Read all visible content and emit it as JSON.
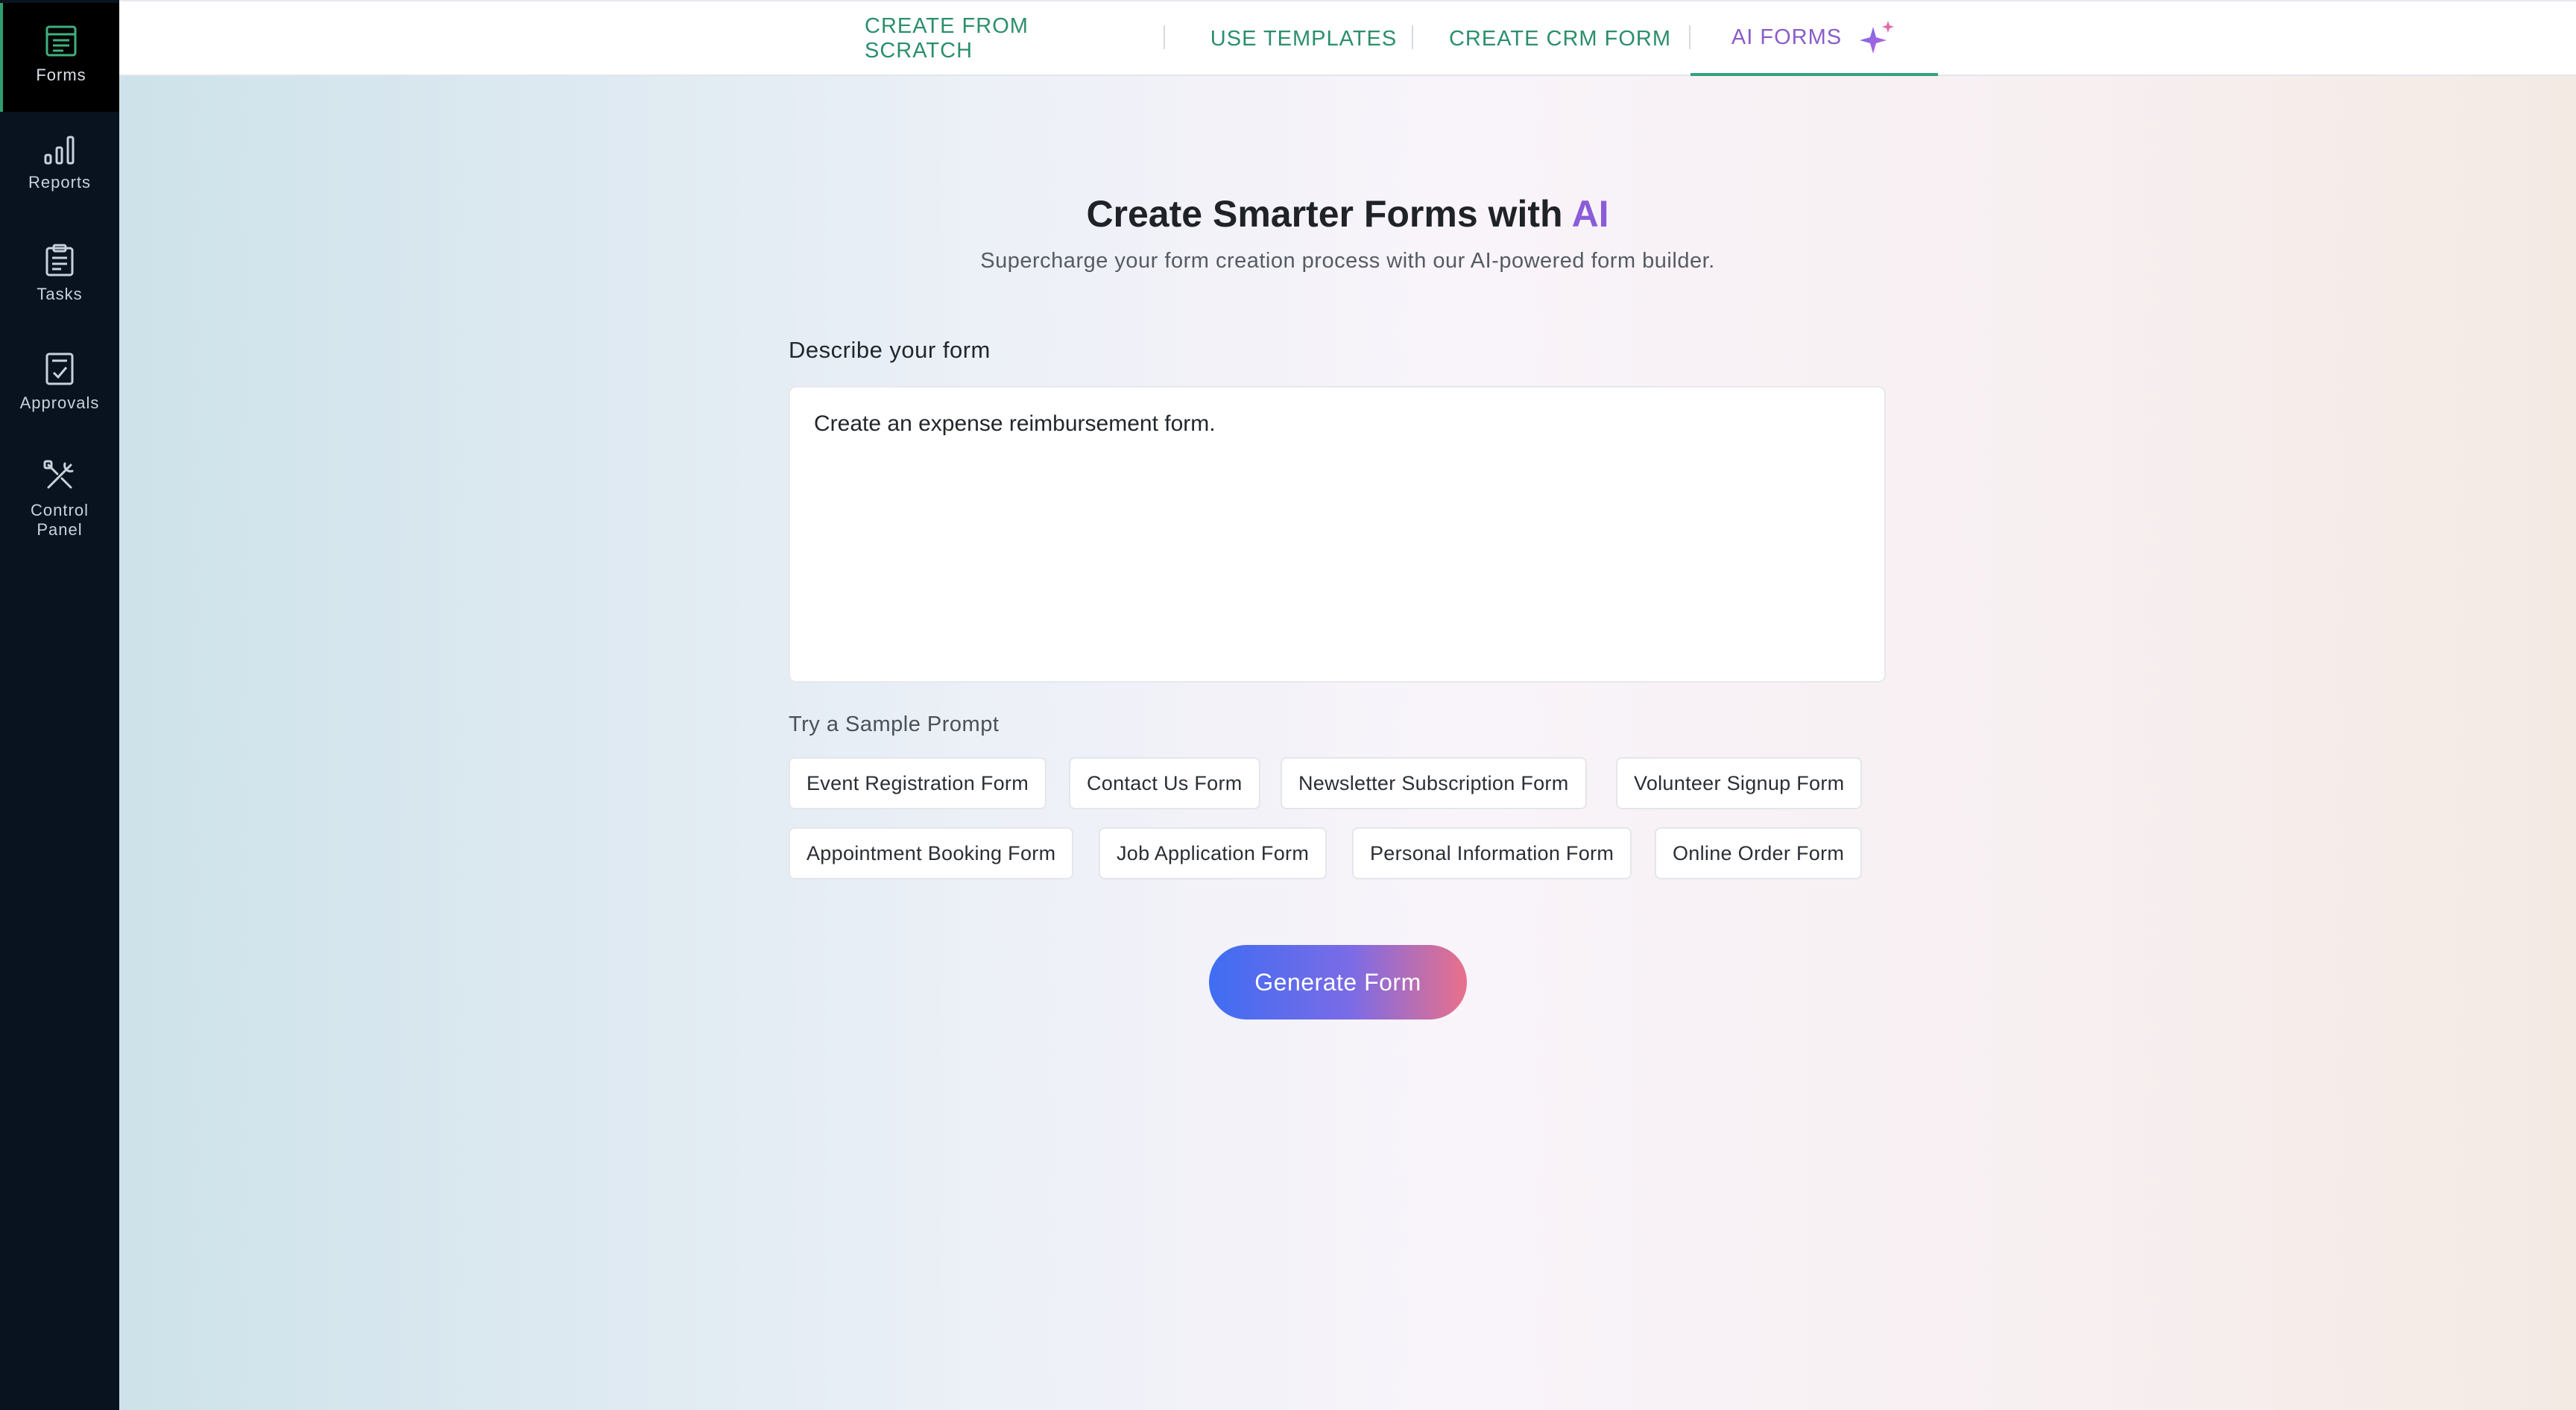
{
  "sidebar": {
    "items": [
      {
        "label": "Forms",
        "icon": "forms-icon",
        "active": true
      },
      {
        "label": "Reports",
        "icon": "bar-chart-icon"
      },
      {
        "label": "Tasks",
        "icon": "clipboard-icon"
      },
      {
        "label": "Approvals",
        "icon": "approval-check-icon"
      },
      {
        "label": "Control Panel",
        "label_line1": "Control",
        "label_line2": "Panel",
        "icon": "tools-icon"
      }
    ]
  },
  "topnav": {
    "tabs": [
      {
        "label": "CREATE FROM SCRATCH"
      },
      {
        "label": "USE TEMPLATES"
      },
      {
        "label": "CREATE CRM FORM"
      },
      {
        "label": "AI FORMS",
        "active": true,
        "icon": "sparkle-icon"
      }
    ]
  },
  "hero": {
    "title_prefix": "Create Smarter Forms with ",
    "title_highlight": "AI",
    "subtitle": "Supercharge your form creation process with our AI-powered form builder."
  },
  "prompt": {
    "label": "Describe your form",
    "value": "Create an expense reimbursement form."
  },
  "samples": {
    "label": "Try a Sample Prompt",
    "chips": [
      "Event Registration Form",
      "Contact Us Form",
      "Newsletter Subscription Form",
      "Volunteer Signup Form",
      "Appointment Booking Form",
      "Job Application Form",
      "Personal Information Form",
      "Online Order Form"
    ]
  },
  "actions": {
    "generate_label": "Generate Form"
  },
  "colors": {
    "sidebar_bg": "#08131f",
    "tab_text": "#2b8f6a",
    "active_tab_text": "#8a5cc9",
    "ai_highlight": "#8a5cd8",
    "button_gradient_start": "#3f6df2",
    "button_gradient_end": "#e9708a"
  }
}
